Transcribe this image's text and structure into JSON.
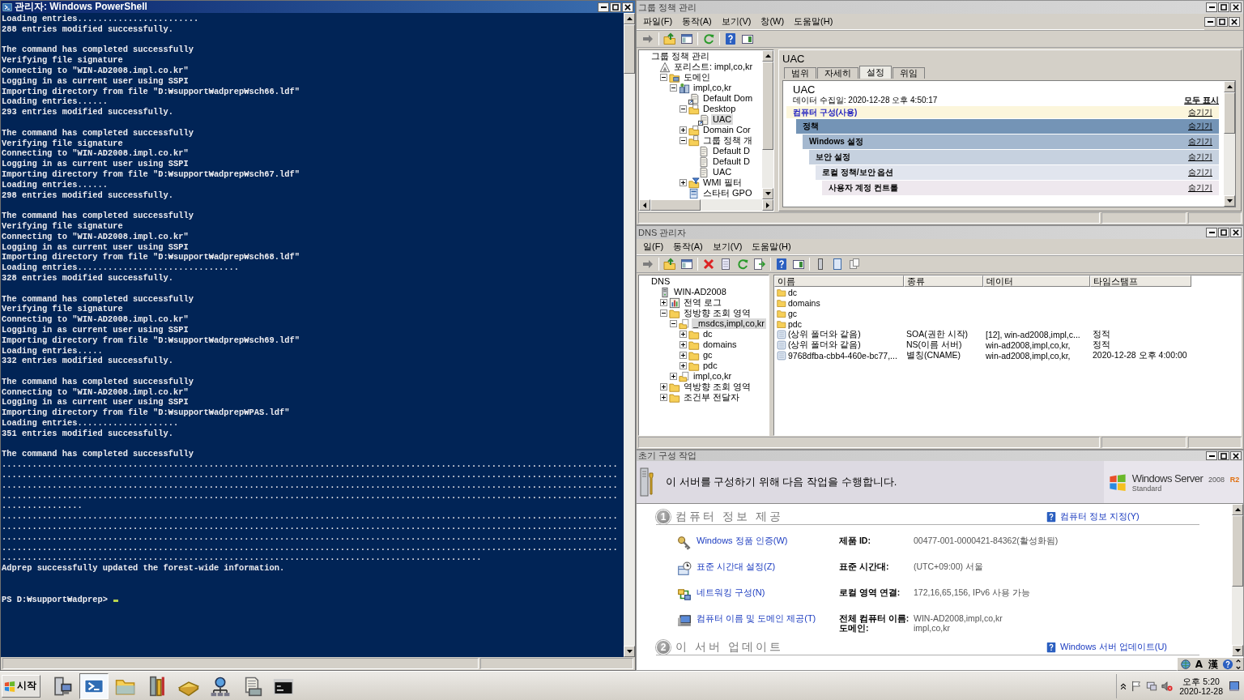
{
  "powershell": {
    "title": "관리자: Windows PowerShell",
    "blocks": [
      [
        "Loading entries........................",
        "288 entries modified successfully."
      ],
      [
        "The command has completed successfully",
        "Verifying file signature",
        "Connecting to \"WIN-AD2008.impl.co.kr\"",
        "Logging in as current user using SSPI",
        "Importing directory from file \"D:₩support₩adprep₩sch66.ldf\"",
        "Loading entries......",
        "293 entries modified successfully."
      ],
      [
        "The command has completed successfully",
        "Verifying file signature",
        "Connecting to \"WIN-AD2008.impl.co.kr\"",
        "Logging in as current user using SSPI",
        "Importing directory from file \"D:₩support₩adprep₩sch67.ldf\"",
        "Loading entries......",
        "298 entries modified successfully."
      ],
      [
        "The command has completed successfully",
        "Verifying file signature",
        "Connecting to \"WIN-AD2008.impl.co.kr\"",
        "Logging in as current user using SSPI",
        "Importing directory from file \"D:₩support₩adprep₩sch68.ldf\"",
        "Loading entries................................",
        "328 entries modified successfully."
      ],
      [
        "The command has completed successfully",
        "Verifying file signature",
        "Connecting to \"WIN-AD2008.impl.co.kr\"",
        "Logging in as current user using SSPI",
        "Importing directory from file \"D:₩support₩adprep₩sch69.ldf\"",
        "Loading entries.....",
        "332 entries modified successfully."
      ],
      [
        "The command has completed successfully",
        "Connecting to \"WIN-AD2008.impl.co.kr\"",
        "Logging in as current user using SSPI",
        "Importing directory from file \"D:₩support₩adprep₩PAS.ldf\"",
        "Loading entries....................",
        "351 entries modified successfully."
      ],
      [
        "The command has completed successfully",
        "..........................................................................................................................",
        "..........................................................................................................................",
        "..........................................................................................................................",
        "..........................................................................................................................",
        "................",
        "..........................................................................................................................",
        "..........................................................................................................................",
        "..........................................................................................................................",
        "..........................................................................................................................",
        "...............................................................................................",
        "Adprep successfully updated the forest-wide information."
      ]
    ],
    "prompt": "PS D:₩support₩adprep>"
  },
  "gpmc": {
    "title": "그룹 정책 관리",
    "menu": [
      "파일(F)",
      "동작(A)",
      "보기(V)",
      "창(W)",
      "도움말(H)"
    ],
    "tree": [
      {
        "label": "그룹 정책 관리",
        "selected": false,
        "children": [
          {
            "kind": "forest",
            "label": "포리스트: impl,co,kr",
            "selected": false,
            "children": [
              {
                "kind": "domains",
                "label": "도메인",
                "expanded": true,
                "selected": false,
                "children": [
                  {
                    "kind": "domain",
                    "label": "impl,co,kr",
                    "expanded": true,
                    "selected": false,
                    "children": [
                      {
                        "kind": "gpo-link",
                        "label": "Default Dom",
                        "selected": false
                      },
                      {
                        "kind": "ou",
                        "label": "Desktop",
                        "expanded": true,
                        "selected": false,
                        "children": [
                          {
                            "kind": "gpo-link",
                            "label": "UAC",
                            "selected": true
                          }
                        ]
                      },
                      {
                        "kind": "ou",
                        "label": "Domain Cor",
                        "expanded": false,
                        "selected": false
                      },
                      {
                        "kind": "gpo-folder",
                        "label": "그룹 정책 개",
                        "expanded": true,
                        "selected": false,
                        "children": [
                          {
                            "kind": "gpo",
                            "label": "Default D",
                            "selected": false
                          },
                          {
                            "kind": "gpo",
                            "label": "Default D",
                            "selected": false
                          },
                          {
                            "kind": "gpo",
                            "label": "UAC",
                            "selected": false
                          }
                        ]
                      },
                      {
                        "kind": "filter",
                        "label": "WMI 필터",
                        "expanded": false,
                        "selected": false
                      },
                      {
                        "kind": "starter",
                        "label": "스타터 GPO",
                        "selected": false
                      }
                    ]
                  }
                ]
              }
            ]
          }
        ]
      }
    ],
    "heading": "UAC",
    "tabs": [
      {
        "label": "범위",
        "selected": false
      },
      {
        "label": "자세히",
        "selected": false
      },
      {
        "label": "설정",
        "selected": true
      },
      {
        "label": "위임",
        "selected": false
      }
    ],
    "report": {
      "title": "UAC",
      "collected": "데이터 수집일: 2020-12-28 오후 4:50:17",
      "show_all": "모두 표시",
      "sections": [
        {
          "label": "컴퓨터 구성(사용)",
          "action": "숨기기",
          "children": [
            {
              "label": "정책",
              "action": "숨기기",
              "children": [
                {
                  "label": "Windows 설정",
                  "action": "숨기기",
                  "children": [
                    {
                      "label": "보안 설정",
                      "action": "숨기기",
                      "children": [
                        {
                          "label": "로컬 정책/보안 옵션",
                          "action": "숨기기",
                          "children": [
                            {
                              "label": "사용자 계정 컨트롤",
                              "action": "숨기기"
                            }
                          ]
                        }
                      ]
                    }
                  ]
                }
              ]
            }
          ]
        }
      ]
    }
  },
  "dns": {
    "title": "DNS 관리자",
    "menu": [
      "일(F)",
      "동작(A)",
      "보기(V)",
      "도움말(H)"
    ],
    "tree": [
      {
        "label": "DNS",
        "selected": false,
        "children": [
          {
            "kind": "server",
            "label": "WIN-AD2008",
            "selected": false,
            "children": [
              {
                "kind": "log",
                "label": "전역 로그",
                "expanded": false,
                "selected": false
              },
              {
                "kind": "folder",
                "label": "정방향 조회 영역",
                "expanded": true,
                "selected": false,
                "children": [
                  {
                    "kind": "zone",
                    "label": "_msdcs,impl,co,kr",
                    "expanded": true,
                    "selected": true,
                    "children": [
                      {
                        "kind": "folder",
                        "label": "dc",
                        "expanded": false,
                        "selected": false
                      },
                      {
                        "kind": "folder",
                        "label": "domains",
                        "expanded": false,
                        "selected": false
                      },
                      {
                        "kind": "folder",
                        "label": "gc",
                        "expanded": false,
                        "selected": false
                      },
                      {
                        "kind": "folder",
                        "label": "pdc",
                        "expanded": false,
                        "selected": false
                      }
                    ]
                  },
                  {
                    "kind": "zone",
                    "label": "impl,co,kr",
                    "expanded": false,
                    "selected": false
                  }
                ]
              },
              {
                "kind": "folder",
                "label": "역방향 조회 영역",
                "expanded": false,
                "selected": false
              },
              {
                "kind": "folder",
                "label": "조건부 전달자",
                "expanded": false,
                "selected": false
              }
            ]
          }
        ]
      }
    ],
    "columns": [
      "이름",
      "종류",
      "데이터",
      "타임스탬프"
    ],
    "rows": [
      {
        "kind": "folder",
        "cells": [
          "dc"
        ]
      },
      {
        "kind": "folder",
        "cells": [
          "domains"
        ]
      },
      {
        "kind": "folder",
        "cells": [
          "gc"
        ]
      },
      {
        "kind": "folder",
        "cells": [
          "pdc"
        ]
      },
      {
        "kind": "record",
        "cells": [
          "(상위 폴더와 같음)",
          "SOA(권한 시작)",
          "[12], win-ad2008,impl,c...",
          "정적"
        ]
      },
      {
        "kind": "record",
        "cells": [
          "(상위 폴더와 같음)",
          "NS(이름 서버)",
          "win-ad2008,impl,co,kr,",
          "정적"
        ]
      },
      {
        "kind": "record",
        "cells": [
          "9768dfba-cbb4-460e-bc77,...",
          "별칭(CNAME)",
          "win-ad2008,impl,co,kr,",
          "2020-12-28 오후 4:00:00"
        ]
      }
    ]
  },
  "ict": {
    "title": "초기 구성 작업",
    "banner": "이 서버를 구성하기 위해 다음 작업을 수행합니다.",
    "logo": {
      "name": "Windows Server",
      "version": "2008",
      "mark": "R2",
      "edition": "Standard"
    },
    "sections": [
      {
        "number": "1",
        "title": "컴퓨터 정보 제공",
        "link": "컴퓨터 정보 지정(Y)",
        "tasks": [
          {
            "kind": "key",
            "link": "Windows 정품 인증(W)",
            "fields": [
              {
                "label": "제품 ID:",
                "value": "00477-001-0000421-84362(활성화됨)"
              }
            ]
          },
          {
            "kind": "clock",
            "link": "표준 시간대 설정(Z)",
            "fields": [
              {
                "label": "표준 시간대:",
                "value": "(UTC+09:00) 서울"
              }
            ]
          },
          {
            "kind": "network",
            "link": "네트워킹 구성(N)",
            "fields": [
              {
                "label": "로컬 영역 연결:",
                "value": "172,16,65,156, IPv6 사용 가능"
              }
            ]
          },
          {
            "kind": "computer",
            "link": "컴퓨터 이름 및 도메인 제공(T)",
            "fields": [
              {
                "label": "전체 컴퓨터 이름:",
                "value": "WIN-AD2008,impl,co,kr"
              },
              {
                "label": "도메인:",
                "value": "impl,co,kr"
              }
            ]
          }
        ]
      },
      {
        "number": "2",
        "title": "이 서버 업데이트",
        "link": "Windows 서버 업데이트(U)"
      }
    ]
  },
  "language_bar": {
    "items": [
      "A",
      "漢"
    ]
  },
  "taskbar": {
    "start": "시작",
    "apps": [
      {
        "kind": "server-manager",
        "selected": false
      },
      {
        "kind": "powershell",
        "selected": true
      },
      {
        "kind": "explorer",
        "selected": false
      },
      {
        "kind": "tools",
        "selected": false
      },
      {
        "kind": "book",
        "selected": false
      },
      {
        "kind": "network",
        "selected": false
      },
      {
        "kind": "document",
        "selected": false
      },
      {
        "kind": "console",
        "selected": false
      }
    ],
    "clock": {
      "time": "오후 5:20",
      "date": "2020-12-28"
    }
  }
}
